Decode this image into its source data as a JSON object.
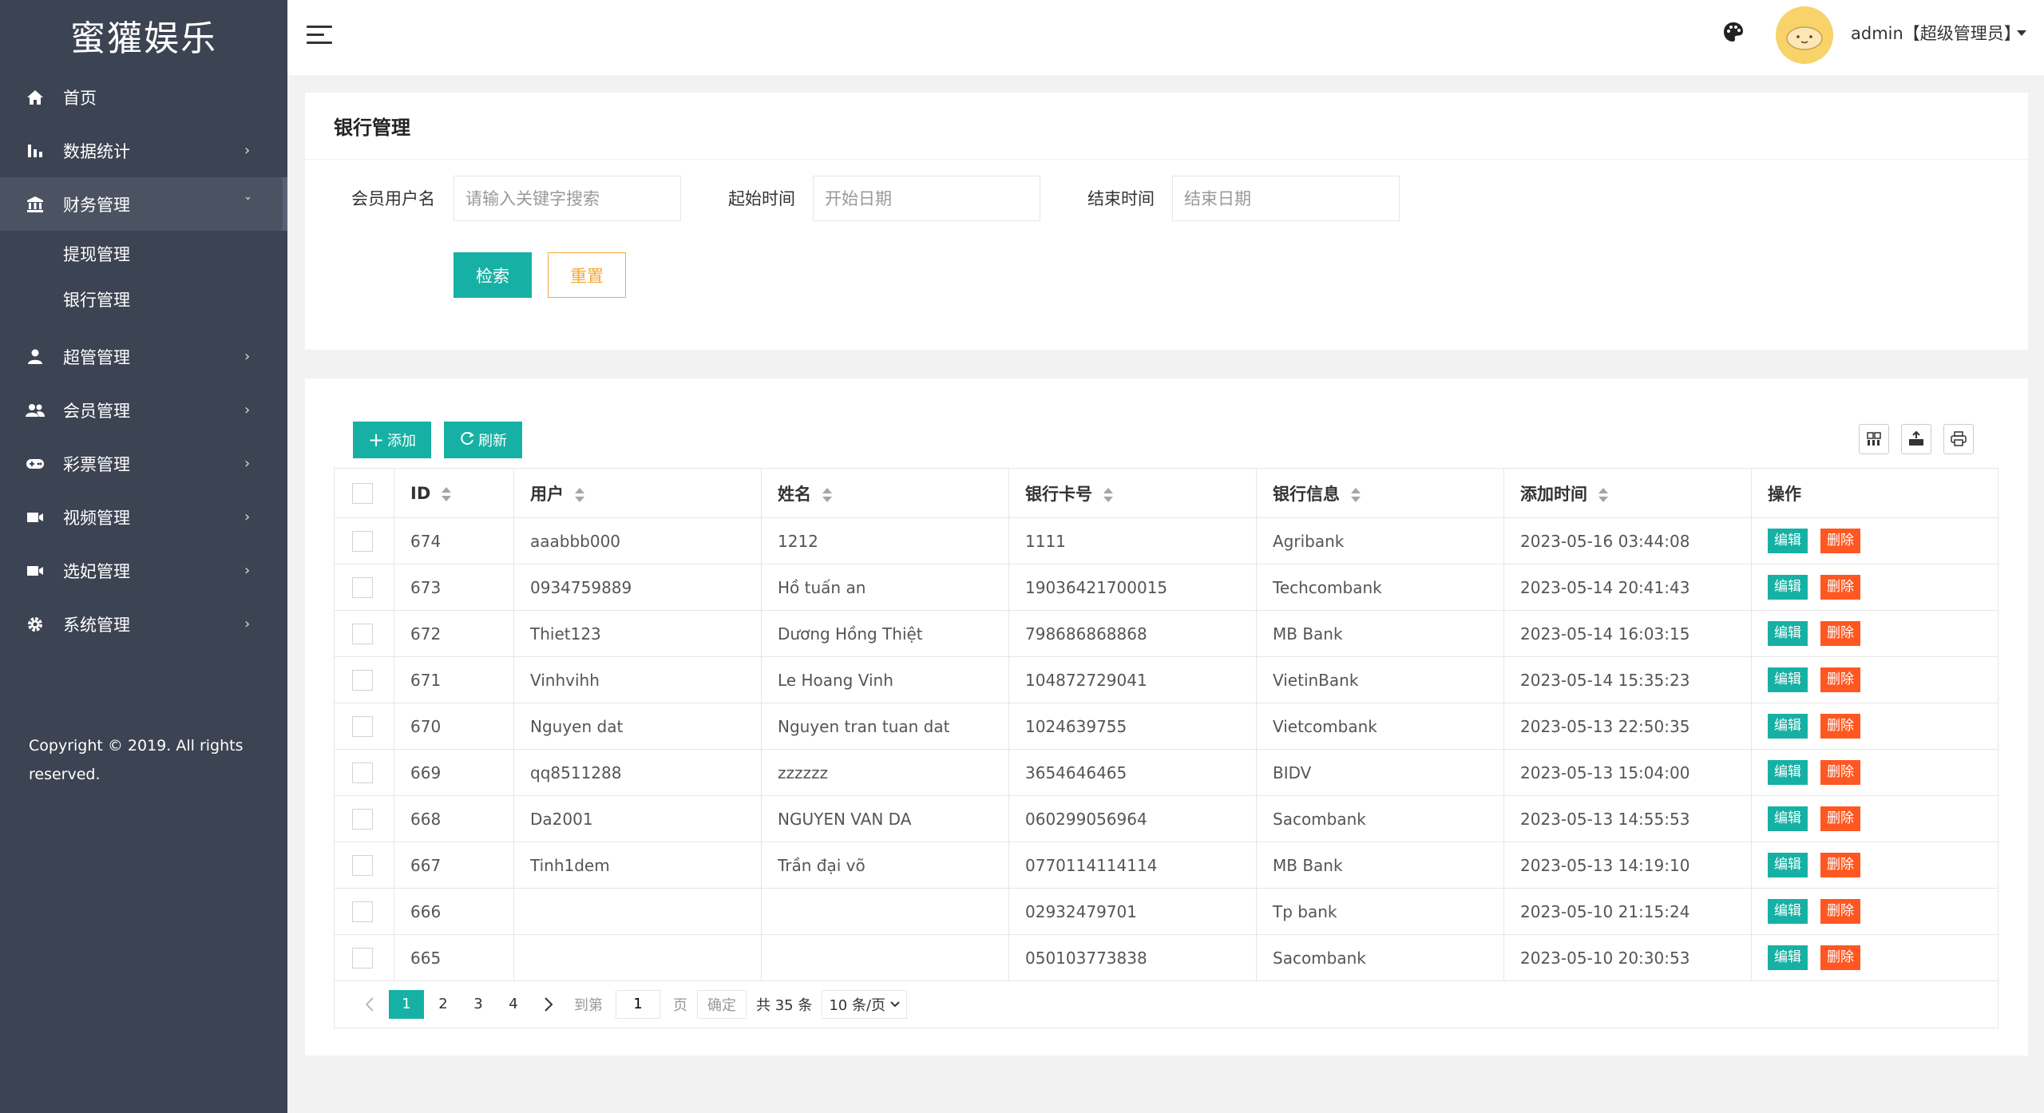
{
  "app": {
    "logo": "蜜獾娱乐"
  },
  "sidebar": {
    "items": [
      {
        "label": "首页",
        "icon": "home-icon"
      },
      {
        "label": "数据统计",
        "icon": "bar-chart-icon"
      },
      {
        "label": "财务管理",
        "icon": "bank-icon"
      },
      {
        "label": "超管管理",
        "icon": "user-icon"
      },
      {
        "label": "会员管理",
        "icon": "users-icon"
      },
      {
        "label": "彩票管理",
        "icon": "gamepad-icon"
      },
      {
        "label": "视频管理",
        "icon": "video-icon"
      },
      {
        "label": "选妃管理",
        "icon": "video-icon"
      },
      {
        "label": "系统管理",
        "icon": "gear-icon"
      }
    ],
    "sub_items": [
      "提现管理",
      "银行管理"
    ],
    "arrow": "›",
    "arrow_open": "ˇ",
    "copyright": "Copyright © 2019. All rights reserved."
  },
  "header": {
    "user": "admin【超级管理员】"
  },
  "search": {
    "title": "银行管理",
    "username_label": "会员用户名",
    "username_placeholder": "请输入关键字搜索",
    "start_label": "起始时间",
    "start_placeholder": "开始日期",
    "end_label": "结束时间",
    "end_placeholder": "结束日期",
    "search_btn": "检索",
    "reset_btn": "重置"
  },
  "toolbar": {
    "add": "添加",
    "refresh": "刷新"
  },
  "table": {
    "columns": [
      "ID",
      "用户",
      "姓名",
      "银行卡号",
      "银行信息",
      "添加时间",
      "操作"
    ],
    "edit_label": "编辑",
    "delete_label": "删除",
    "rows": [
      {
        "id": "674",
        "user": "aaabbb000",
        "name": "1212",
        "card": "1111",
        "bank": "Agribank",
        "time": "2023-05-16 03:44:08"
      },
      {
        "id": "673",
        "user": "0934759889",
        "name": "Hồ tuấn an",
        "card": "19036421700015",
        "bank": "Techcombank",
        "time": "2023-05-14 20:41:43"
      },
      {
        "id": "672",
        "user": "Thiet123",
        "name": "Dương Hồng Thiệt",
        "card": "798686868868",
        "bank": "MB Bank",
        "time": "2023-05-14 16:03:15"
      },
      {
        "id": "671",
        "user": "Vinhvihh",
        "name": "Le Hoang Vinh",
        "card": "104872729041",
        "bank": "VietinBank",
        "time": "2023-05-14 15:35:23"
      },
      {
        "id": "670",
        "user": "Nguyen dat",
        "name": "Nguyen tran tuan dat",
        "card": "1024639755",
        "bank": "Vietcombank",
        "time": "2023-05-13 22:50:35"
      },
      {
        "id": "669",
        "user": "qq8511288",
        "name": "zzzzzz",
        "card": "3654646465",
        "bank": "BIDV",
        "time": "2023-05-13 15:04:00"
      },
      {
        "id": "668",
        "user": "Da2001",
        "name": "NGUYEN VAN DA",
        "card": "060299056964",
        "bank": "Sacombank",
        "time": "2023-05-13 14:55:53"
      },
      {
        "id": "667",
        "user": "Tinh1dem",
        "name": "Trần đại võ",
        "card": "0770114114114",
        "bank": "MB Bank",
        "time": "2023-05-13 14:19:10"
      },
      {
        "id": "666",
        "user": "",
        "name": "",
        "card": "02932479701",
        "bank": "Tp bank",
        "time": "2023-05-10 21:15:24"
      },
      {
        "id": "665",
        "user": "",
        "name": "",
        "card": "050103773838",
        "bank": "Sacombank",
        "time": "2023-05-10 20:30:53"
      }
    ]
  },
  "pagination": {
    "pages": [
      "1",
      "2",
      "3",
      "4"
    ],
    "current": "1",
    "goto_label": "到第",
    "goto_value": "1",
    "page_unit": "页",
    "confirm": "确定",
    "total": "共 35 条",
    "per_page": "10 条/页"
  },
  "colors": {
    "sidebar": "#3c4352",
    "primary": "#16b1a4",
    "danger": "#ff5722",
    "warning": "#f2a93b"
  }
}
